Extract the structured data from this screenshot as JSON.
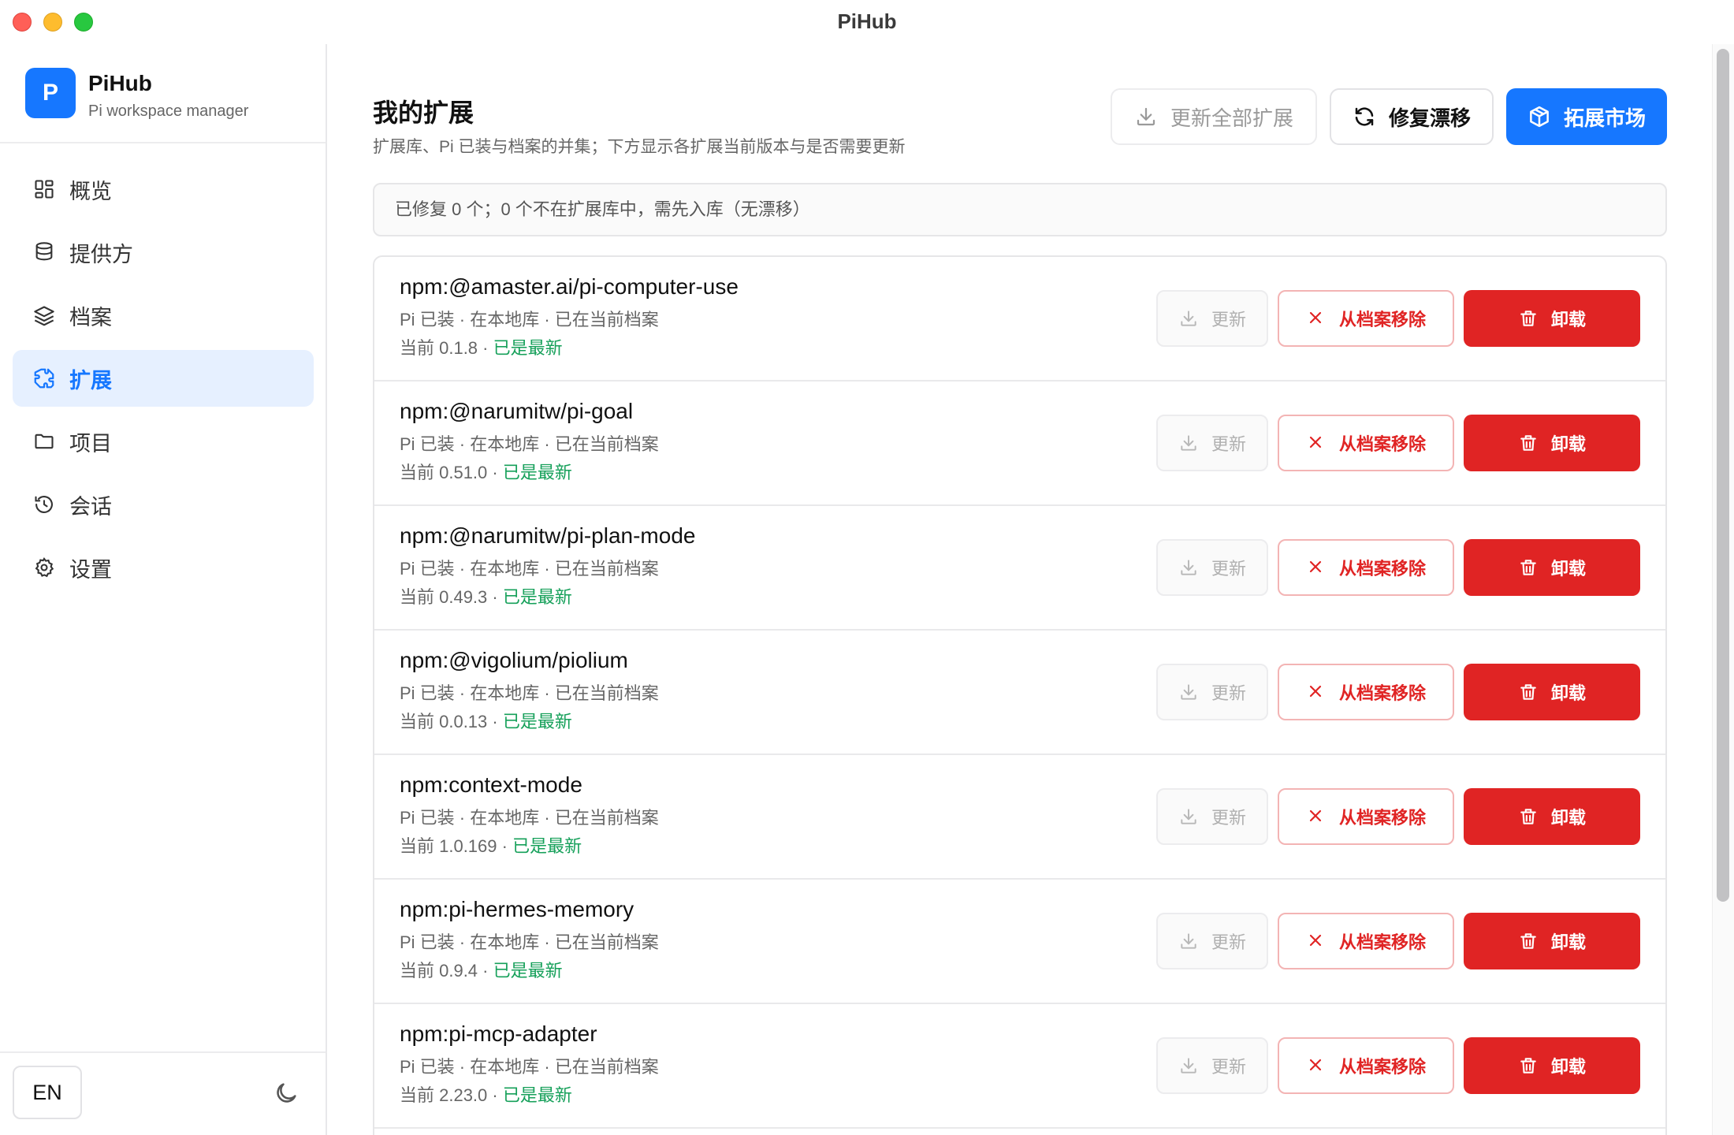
{
  "window": {
    "title": "PiHub"
  },
  "brand": {
    "logo_letter": "P",
    "name": "PiHub",
    "subtitle": "Pi workspace manager"
  },
  "sidebar": {
    "items": [
      {
        "label": "概览",
        "icon": "dashboard-icon",
        "active": false
      },
      {
        "label": "提供方",
        "icon": "database-icon",
        "active": false
      },
      {
        "label": "档案",
        "icon": "layers-icon",
        "active": false
      },
      {
        "label": "扩展",
        "icon": "puzzle-icon",
        "active": true
      },
      {
        "label": "项目",
        "icon": "folder-icon",
        "active": false
      },
      {
        "label": "会话",
        "icon": "history-icon",
        "active": false
      },
      {
        "label": "设置",
        "icon": "gear-icon",
        "active": false
      }
    ],
    "language_label": "EN",
    "theme_icon": "moon-icon"
  },
  "main": {
    "title": "我的扩展",
    "subtitle": "扩展库、Pi 已装与档案的并集；下方显示各扩展当前版本与是否需要更新",
    "buttons": {
      "update_all": "更新全部扩展",
      "fix_drift": "修复漂移",
      "market": "拓展市场"
    },
    "notice": "已修复 0 个；0 个不在扩展库中，需先入库（无漂移）"
  },
  "row_labels": {
    "update": "更新",
    "remove": "从档案移除",
    "uninstall": "卸载"
  },
  "extensions": [
    {
      "name": "npm:@amaster.ai/pi-computer-use",
      "meta": "Pi 已装 · 在本地库 · 已在当前档案",
      "version_prefix": "当前 0.1.8 · ",
      "status": "已是最新"
    },
    {
      "name": "npm:@narumitw/pi-goal",
      "meta": "Pi 已装 · 在本地库 · 已在当前档案",
      "version_prefix": "当前 0.51.0 · ",
      "status": "已是最新"
    },
    {
      "name": "npm:@narumitw/pi-plan-mode",
      "meta": "Pi 已装 · 在本地库 · 已在当前档案",
      "version_prefix": "当前 0.49.3 · ",
      "status": "已是最新"
    },
    {
      "name": "npm:@vigolium/piolium",
      "meta": "Pi 已装 · 在本地库 · 已在当前档案",
      "version_prefix": "当前 0.0.13 · ",
      "status": "已是最新"
    },
    {
      "name": "npm:context-mode",
      "meta": "Pi 已装 · 在本地库 · 已在当前档案",
      "version_prefix": "当前 1.0.169 · ",
      "status": "已是最新"
    },
    {
      "name": "npm:pi-hermes-memory",
      "meta": "Pi 已装 · 在本地库 · 已在当前档案",
      "version_prefix": "当前 0.9.4 · ",
      "status": "已是最新"
    },
    {
      "name": "npm:pi-mcp-adapter",
      "meta": "Pi 已装 · 在本地库 · 已在当前档案",
      "version_prefix": "当前 2.23.0 · ",
      "status": "已是最新"
    }
  ],
  "colors": {
    "accent": "#1677ff",
    "danger": "#e02424",
    "success": "#16a05a"
  }
}
